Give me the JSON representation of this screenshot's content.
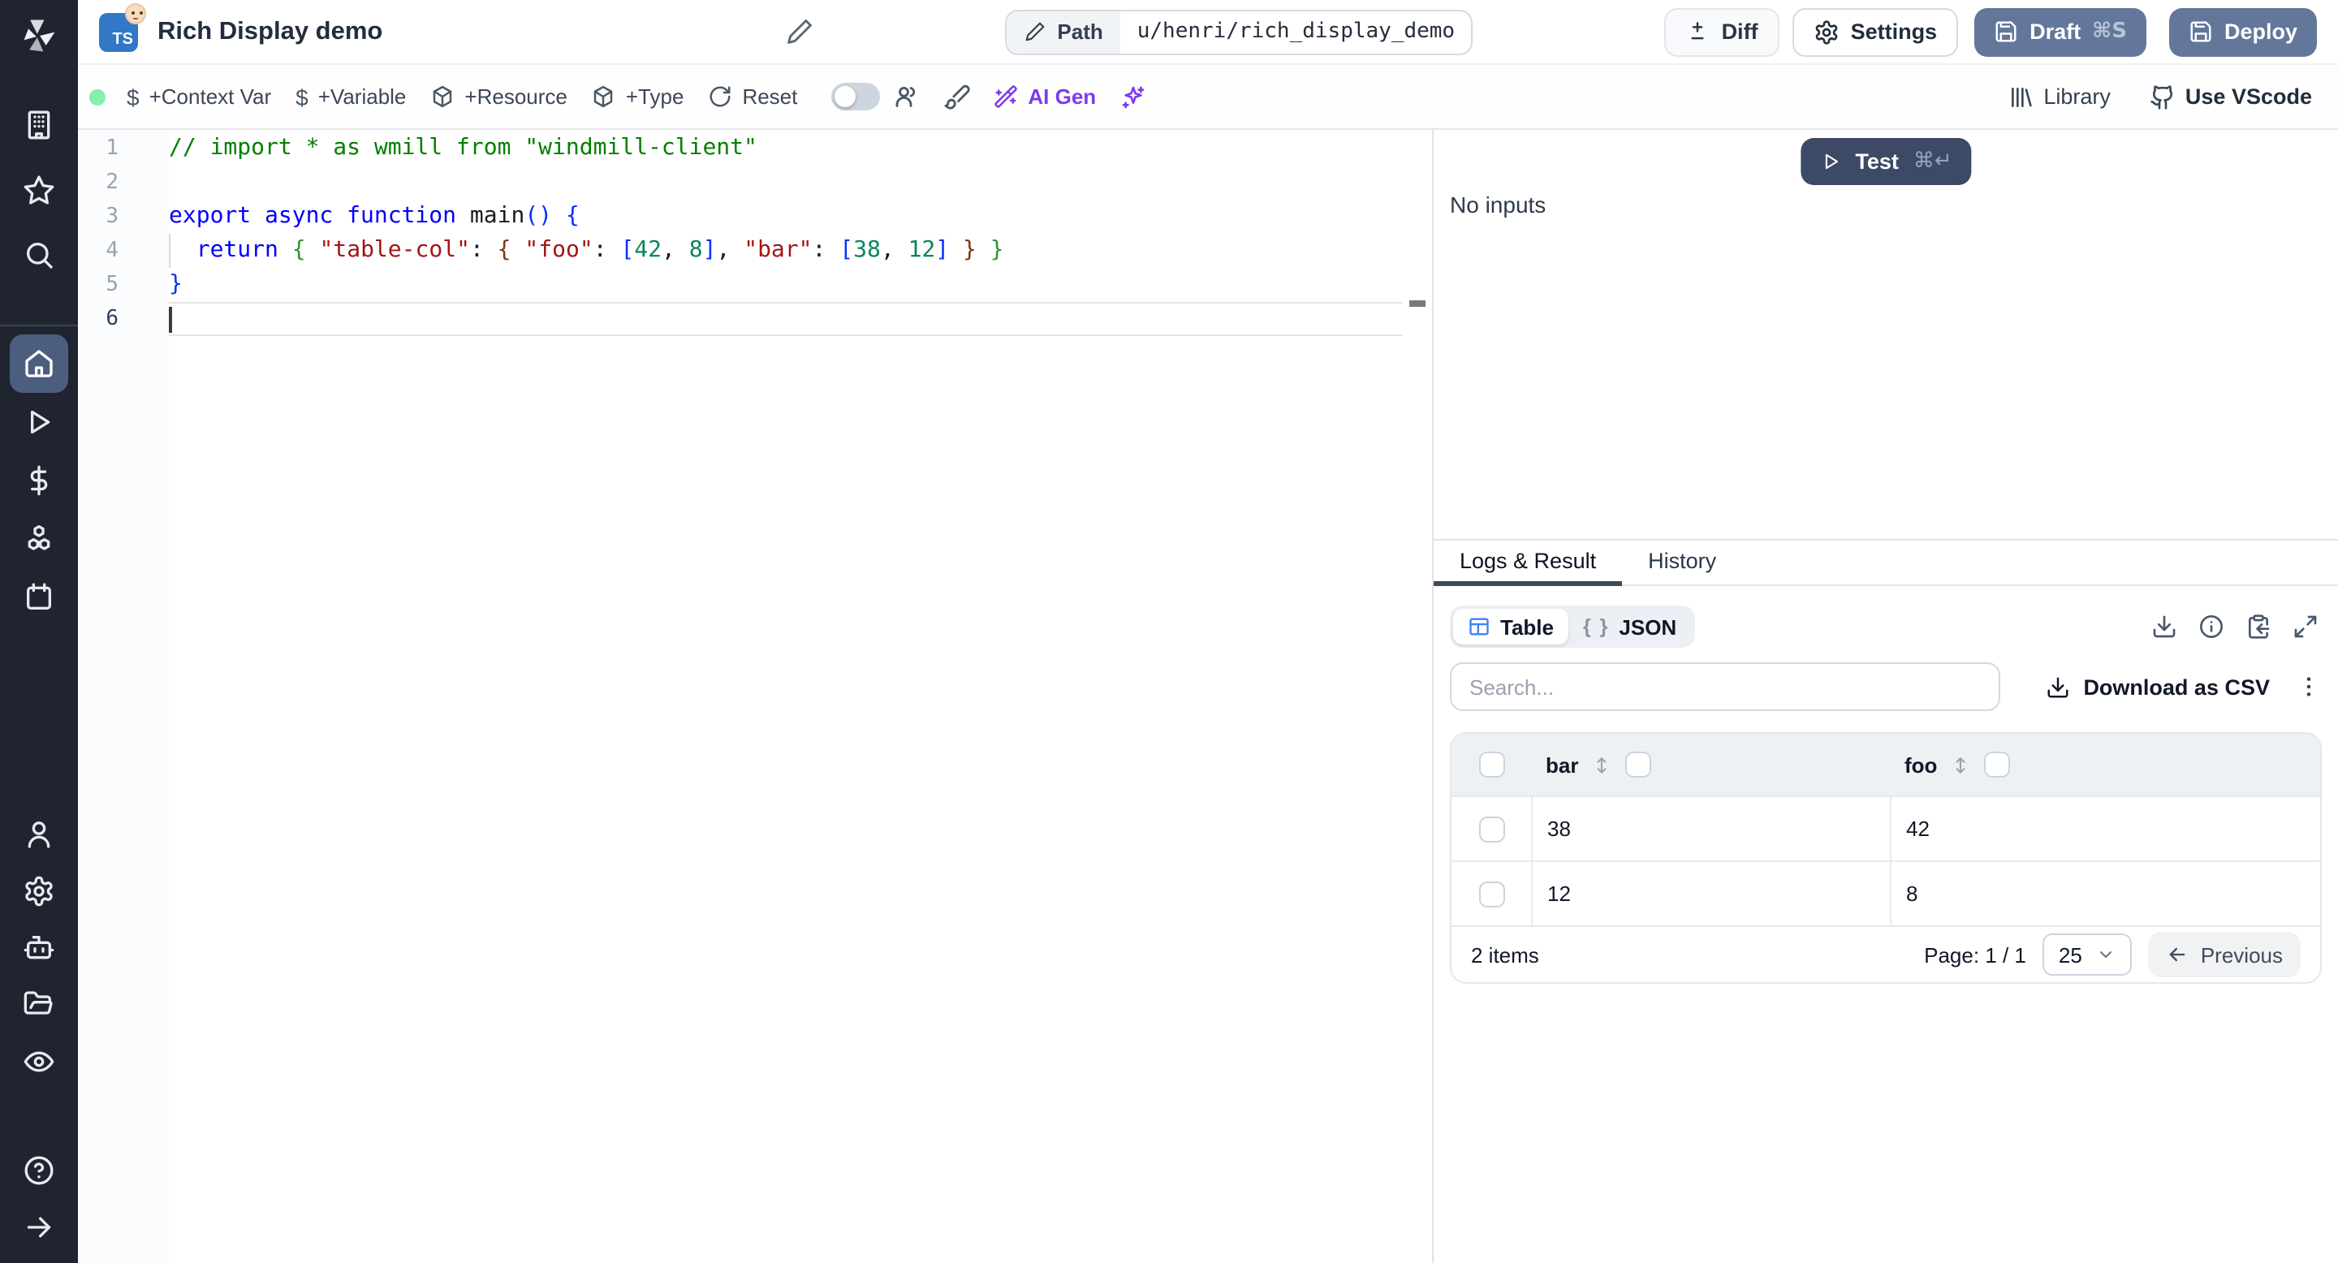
{
  "header": {
    "title": "Rich Display demo",
    "path_label": "Path",
    "path_value": "u/henri/rich_display_demo",
    "diff_label": "Diff",
    "settings_label": "Settings",
    "draft_label": "Draft",
    "draft_shortcut": "⌘S",
    "deploy_label": "Deploy"
  },
  "toolbar": {
    "context_var": "+Context Var",
    "variable": "+Variable",
    "resource": "+Resource",
    "type": "+Type",
    "reset": "Reset",
    "ai_gen": "AI Gen",
    "library": "Library",
    "use_vscode": "Use VScode"
  },
  "editor": {
    "language_badge": "TS",
    "line_numbers": [
      "1",
      "2",
      "3",
      "4",
      "5",
      "6"
    ],
    "active_line": 6,
    "lines": [
      [
        {
          "t": "// import * as wmill from \"windmill-client\"",
          "c": "com"
        }
      ],
      [],
      [
        {
          "t": "export async function ",
          "c": "kw"
        },
        {
          "t": "main",
          "c": "def"
        },
        {
          "t": "() {",
          "c": "br1"
        }
      ],
      [
        {
          "t": "  ",
          "c": "def"
        },
        {
          "t": "return",
          "c": "kw"
        },
        {
          "t": " ",
          "c": "def"
        },
        {
          "t": "{",
          "c": "br2"
        },
        {
          "t": " ",
          "c": "def"
        },
        {
          "t": "\"table-col\"",
          "c": "str"
        },
        {
          "t": ": ",
          "c": "def"
        },
        {
          "t": "{",
          "c": "br3"
        },
        {
          "t": " ",
          "c": "def"
        },
        {
          "t": "\"foo\"",
          "c": "str"
        },
        {
          "t": ": ",
          "c": "def"
        },
        {
          "t": "[",
          "c": "br1"
        },
        {
          "t": "42",
          "c": "num"
        },
        {
          "t": ", ",
          "c": "def"
        },
        {
          "t": "8",
          "c": "num"
        },
        {
          "t": "]",
          "c": "br1"
        },
        {
          "t": ", ",
          "c": "def"
        },
        {
          "t": "\"bar\"",
          "c": "str"
        },
        {
          "t": ": ",
          "c": "def"
        },
        {
          "t": "[",
          "c": "br1"
        },
        {
          "t": "38",
          "c": "num"
        },
        {
          "t": ", ",
          "c": "def"
        },
        {
          "t": "12",
          "c": "num"
        },
        {
          "t": "]",
          "c": "br1"
        },
        {
          "t": " ",
          "c": "def"
        },
        {
          "t": "}",
          "c": "br3"
        },
        {
          "t": " ",
          "c": "def"
        },
        {
          "t": "}",
          "c": "br2"
        }
      ],
      [
        {
          "t": "}",
          "c": "br1"
        }
      ],
      []
    ]
  },
  "run": {
    "test_label": "Test",
    "test_shortcut": "⌘↵",
    "no_inputs": "No inputs"
  },
  "result": {
    "tabs": [
      {
        "label": "Logs & Result",
        "active": true
      },
      {
        "label": "History",
        "active": false
      }
    ],
    "view_toggle": {
      "table": "Table",
      "json": "JSON",
      "json_braces": "{ }"
    },
    "search_placeholder": "Search...",
    "download_csv": "Download as CSV"
  },
  "table": {
    "columns": [
      "bar",
      "foo"
    ],
    "rows": [
      [
        "38",
        "42"
      ],
      [
        "12",
        "8"
      ]
    ],
    "summary": "2 items",
    "page": "Page: 1 / 1",
    "page_size": "25",
    "previous": "Previous"
  },
  "colors": {
    "accent_blue": "#3b82f6",
    "ai_purple": "#7c3aed",
    "primary_button_blue": "#63779b",
    "test_button_navy": "#3d4a66",
    "status_green": "#86efac",
    "sidebar_dark": "#1f2430"
  }
}
